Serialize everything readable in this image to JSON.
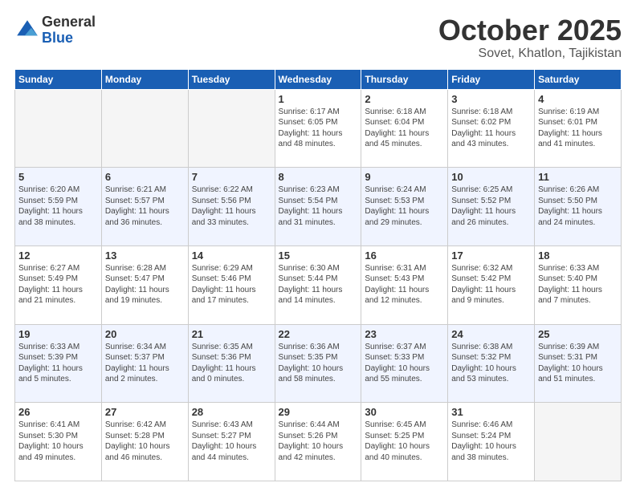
{
  "logo": {
    "general": "General",
    "blue": "Blue"
  },
  "header": {
    "month": "October 2025",
    "location": "Sovet, Khatlon, Tajikistan"
  },
  "weekdays": [
    "Sunday",
    "Monday",
    "Tuesday",
    "Wednesday",
    "Thursday",
    "Friday",
    "Saturday"
  ],
  "weeks": [
    [
      {
        "day": "",
        "info": ""
      },
      {
        "day": "",
        "info": ""
      },
      {
        "day": "",
        "info": ""
      },
      {
        "day": "1",
        "info": "Sunrise: 6:17 AM\nSunset: 6:05 PM\nDaylight: 11 hours\nand 48 minutes."
      },
      {
        "day": "2",
        "info": "Sunrise: 6:18 AM\nSunset: 6:04 PM\nDaylight: 11 hours\nand 45 minutes."
      },
      {
        "day": "3",
        "info": "Sunrise: 6:18 AM\nSunset: 6:02 PM\nDaylight: 11 hours\nand 43 minutes."
      },
      {
        "day": "4",
        "info": "Sunrise: 6:19 AM\nSunset: 6:01 PM\nDaylight: 11 hours\nand 41 minutes."
      }
    ],
    [
      {
        "day": "5",
        "info": "Sunrise: 6:20 AM\nSunset: 5:59 PM\nDaylight: 11 hours\nand 38 minutes."
      },
      {
        "day": "6",
        "info": "Sunrise: 6:21 AM\nSunset: 5:57 PM\nDaylight: 11 hours\nand 36 minutes."
      },
      {
        "day": "7",
        "info": "Sunrise: 6:22 AM\nSunset: 5:56 PM\nDaylight: 11 hours\nand 33 minutes."
      },
      {
        "day": "8",
        "info": "Sunrise: 6:23 AM\nSunset: 5:54 PM\nDaylight: 11 hours\nand 31 minutes."
      },
      {
        "day": "9",
        "info": "Sunrise: 6:24 AM\nSunset: 5:53 PM\nDaylight: 11 hours\nand 29 minutes."
      },
      {
        "day": "10",
        "info": "Sunrise: 6:25 AM\nSunset: 5:52 PM\nDaylight: 11 hours\nand 26 minutes."
      },
      {
        "day": "11",
        "info": "Sunrise: 6:26 AM\nSunset: 5:50 PM\nDaylight: 11 hours\nand 24 minutes."
      }
    ],
    [
      {
        "day": "12",
        "info": "Sunrise: 6:27 AM\nSunset: 5:49 PM\nDaylight: 11 hours\nand 21 minutes."
      },
      {
        "day": "13",
        "info": "Sunrise: 6:28 AM\nSunset: 5:47 PM\nDaylight: 11 hours\nand 19 minutes."
      },
      {
        "day": "14",
        "info": "Sunrise: 6:29 AM\nSunset: 5:46 PM\nDaylight: 11 hours\nand 17 minutes."
      },
      {
        "day": "15",
        "info": "Sunrise: 6:30 AM\nSunset: 5:44 PM\nDaylight: 11 hours\nand 14 minutes."
      },
      {
        "day": "16",
        "info": "Sunrise: 6:31 AM\nSunset: 5:43 PM\nDaylight: 11 hours\nand 12 minutes."
      },
      {
        "day": "17",
        "info": "Sunrise: 6:32 AM\nSunset: 5:42 PM\nDaylight: 11 hours\nand 9 minutes."
      },
      {
        "day": "18",
        "info": "Sunrise: 6:33 AM\nSunset: 5:40 PM\nDaylight: 11 hours\nand 7 minutes."
      }
    ],
    [
      {
        "day": "19",
        "info": "Sunrise: 6:33 AM\nSunset: 5:39 PM\nDaylight: 11 hours\nand 5 minutes."
      },
      {
        "day": "20",
        "info": "Sunrise: 6:34 AM\nSunset: 5:37 PM\nDaylight: 11 hours\nand 2 minutes."
      },
      {
        "day": "21",
        "info": "Sunrise: 6:35 AM\nSunset: 5:36 PM\nDaylight: 11 hours\nand 0 minutes."
      },
      {
        "day": "22",
        "info": "Sunrise: 6:36 AM\nSunset: 5:35 PM\nDaylight: 10 hours\nand 58 minutes."
      },
      {
        "day": "23",
        "info": "Sunrise: 6:37 AM\nSunset: 5:33 PM\nDaylight: 10 hours\nand 55 minutes."
      },
      {
        "day": "24",
        "info": "Sunrise: 6:38 AM\nSunset: 5:32 PM\nDaylight: 10 hours\nand 53 minutes."
      },
      {
        "day": "25",
        "info": "Sunrise: 6:39 AM\nSunset: 5:31 PM\nDaylight: 10 hours\nand 51 minutes."
      }
    ],
    [
      {
        "day": "26",
        "info": "Sunrise: 6:41 AM\nSunset: 5:30 PM\nDaylight: 10 hours\nand 49 minutes."
      },
      {
        "day": "27",
        "info": "Sunrise: 6:42 AM\nSunset: 5:28 PM\nDaylight: 10 hours\nand 46 minutes."
      },
      {
        "day": "28",
        "info": "Sunrise: 6:43 AM\nSunset: 5:27 PM\nDaylight: 10 hours\nand 44 minutes."
      },
      {
        "day": "29",
        "info": "Sunrise: 6:44 AM\nSunset: 5:26 PM\nDaylight: 10 hours\nand 42 minutes."
      },
      {
        "day": "30",
        "info": "Sunrise: 6:45 AM\nSunset: 5:25 PM\nDaylight: 10 hours\nand 40 minutes."
      },
      {
        "day": "31",
        "info": "Sunrise: 6:46 AM\nSunset: 5:24 PM\nDaylight: 10 hours\nand 38 minutes."
      },
      {
        "day": "",
        "info": ""
      }
    ]
  ]
}
